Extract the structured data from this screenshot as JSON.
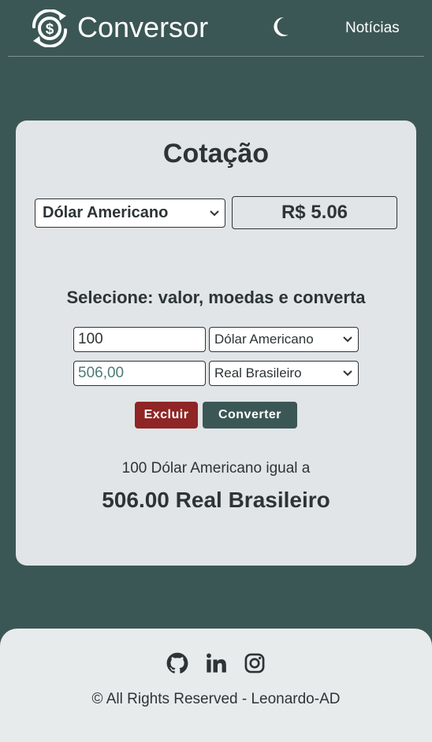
{
  "header": {
    "brand": "Conversor",
    "news_link": "Notícias",
    "logo_icon": "currency-exchange-icon",
    "theme_icon": "moon-icon"
  },
  "quote": {
    "title": "Cotação",
    "currency_selected": "Dólar Americano",
    "rate_value": "R$ 5.06"
  },
  "converter": {
    "subtitle": "Selecione: valor, moedas e converta",
    "amount_value": "100",
    "from_currency": "Dólar Americano",
    "result_value": "506,00",
    "to_currency": "Real Brasileiro",
    "clear_label": "Excluir",
    "convert_label": "Converter",
    "result_line": "100 Dólar Americano igual a",
    "result_big": "506.00 Real Brasileiro"
  },
  "footer": {
    "copyright": "© All Rights Reserved - Leonardo-AD",
    "icons": [
      "github-icon",
      "linkedin-icon",
      "instagram-icon"
    ]
  },
  "colors": {
    "background": "#3b5755",
    "card": "#e1e5e7",
    "clear_button": "#8f2525",
    "convert_button": "#3b5755",
    "result_text": "#4f7a76"
  }
}
